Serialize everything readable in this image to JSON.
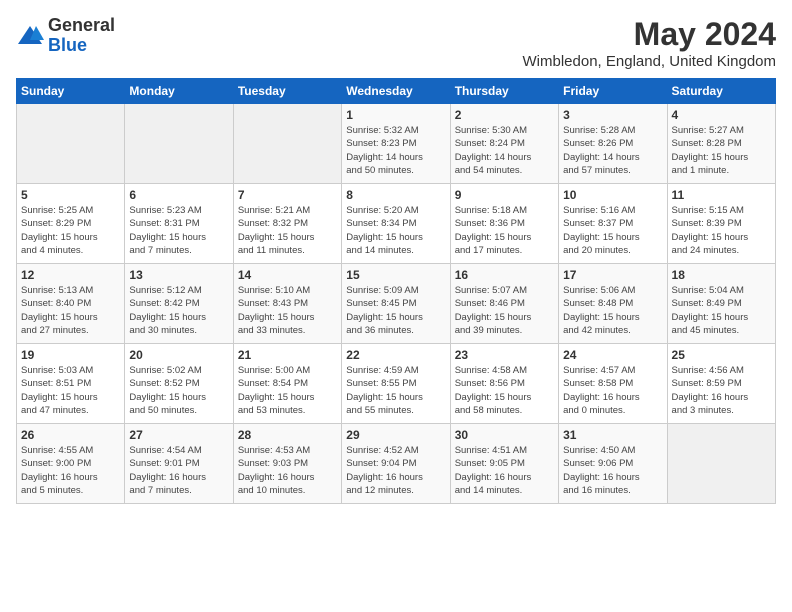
{
  "logo": {
    "general": "General",
    "blue": "Blue"
  },
  "title": "May 2024",
  "location": "Wimbledon, England, United Kingdom",
  "days_of_week": [
    "Sunday",
    "Monday",
    "Tuesday",
    "Wednesday",
    "Thursday",
    "Friday",
    "Saturday"
  ],
  "weeks": [
    [
      {
        "day": "",
        "info": ""
      },
      {
        "day": "",
        "info": ""
      },
      {
        "day": "",
        "info": ""
      },
      {
        "day": "1",
        "info": "Sunrise: 5:32 AM\nSunset: 8:23 PM\nDaylight: 14 hours\nand 50 minutes."
      },
      {
        "day": "2",
        "info": "Sunrise: 5:30 AM\nSunset: 8:24 PM\nDaylight: 14 hours\nand 54 minutes."
      },
      {
        "day": "3",
        "info": "Sunrise: 5:28 AM\nSunset: 8:26 PM\nDaylight: 14 hours\nand 57 minutes."
      },
      {
        "day": "4",
        "info": "Sunrise: 5:27 AM\nSunset: 8:28 PM\nDaylight: 15 hours\nand 1 minute."
      }
    ],
    [
      {
        "day": "5",
        "info": "Sunrise: 5:25 AM\nSunset: 8:29 PM\nDaylight: 15 hours\nand 4 minutes."
      },
      {
        "day": "6",
        "info": "Sunrise: 5:23 AM\nSunset: 8:31 PM\nDaylight: 15 hours\nand 7 minutes."
      },
      {
        "day": "7",
        "info": "Sunrise: 5:21 AM\nSunset: 8:32 PM\nDaylight: 15 hours\nand 11 minutes."
      },
      {
        "day": "8",
        "info": "Sunrise: 5:20 AM\nSunset: 8:34 PM\nDaylight: 15 hours\nand 14 minutes."
      },
      {
        "day": "9",
        "info": "Sunrise: 5:18 AM\nSunset: 8:36 PM\nDaylight: 15 hours\nand 17 minutes."
      },
      {
        "day": "10",
        "info": "Sunrise: 5:16 AM\nSunset: 8:37 PM\nDaylight: 15 hours\nand 20 minutes."
      },
      {
        "day": "11",
        "info": "Sunrise: 5:15 AM\nSunset: 8:39 PM\nDaylight: 15 hours\nand 24 minutes."
      }
    ],
    [
      {
        "day": "12",
        "info": "Sunrise: 5:13 AM\nSunset: 8:40 PM\nDaylight: 15 hours\nand 27 minutes."
      },
      {
        "day": "13",
        "info": "Sunrise: 5:12 AM\nSunset: 8:42 PM\nDaylight: 15 hours\nand 30 minutes."
      },
      {
        "day": "14",
        "info": "Sunrise: 5:10 AM\nSunset: 8:43 PM\nDaylight: 15 hours\nand 33 minutes."
      },
      {
        "day": "15",
        "info": "Sunrise: 5:09 AM\nSunset: 8:45 PM\nDaylight: 15 hours\nand 36 minutes."
      },
      {
        "day": "16",
        "info": "Sunrise: 5:07 AM\nSunset: 8:46 PM\nDaylight: 15 hours\nand 39 minutes."
      },
      {
        "day": "17",
        "info": "Sunrise: 5:06 AM\nSunset: 8:48 PM\nDaylight: 15 hours\nand 42 minutes."
      },
      {
        "day": "18",
        "info": "Sunrise: 5:04 AM\nSunset: 8:49 PM\nDaylight: 15 hours\nand 45 minutes."
      }
    ],
    [
      {
        "day": "19",
        "info": "Sunrise: 5:03 AM\nSunset: 8:51 PM\nDaylight: 15 hours\nand 47 minutes."
      },
      {
        "day": "20",
        "info": "Sunrise: 5:02 AM\nSunset: 8:52 PM\nDaylight: 15 hours\nand 50 minutes."
      },
      {
        "day": "21",
        "info": "Sunrise: 5:00 AM\nSunset: 8:54 PM\nDaylight: 15 hours\nand 53 minutes."
      },
      {
        "day": "22",
        "info": "Sunrise: 4:59 AM\nSunset: 8:55 PM\nDaylight: 15 hours\nand 55 minutes."
      },
      {
        "day": "23",
        "info": "Sunrise: 4:58 AM\nSunset: 8:56 PM\nDaylight: 15 hours\nand 58 minutes."
      },
      {
        "day": "24",
        "info": "Sunrise: 4:57 AM\nSunset: 8:58 PM\nDaylight: 16 hours\nand 0 minutes."
      },
      {
        "day": "25",
        "info": "Sunrise: 4:56 AM\nSunset: 8:59 PM\nDaylight: 16 hours\nand 3 minutes."
      }
    ],
    [
      {
        "day": "26",
        "info": "Sunrise: 4:55 AM\nSunset: 9:00 PM\nDaylight: 16 hours\nand 5 minutes."
      },
      {
        "day": "27",
        "info": "Sunrise: 4:54 AM\nSunset: 9:01 PM\nDaylight: 16 hours\nand 7 minutes."
      },
      {
        "day": "28",
        "info": "Sunrise: 4:53 AM\nSunset: 9:03 PM\nDaylight: 16 hours\nand 10 minutes."
      },
      {
        "day": "29",
        "info": "Sunrise: 4:52 AM\nSunset: 9:04 PM\nDaylight: 16 hours\nand 12 minutes."
      },
      {
        "day": "30",
        "info": "Sunrise: 4:51 AM\nSunset: 9:05 PM\nDaylight: 16 hours\nand 14 minutes."
      },
      {
        "day": "31",
        "info": "Sunrise: 4:50 AM\nSunset: 9:06 PM\nDaylight: 16 hours\nand 16 minutes."
      },
      {
        "day": "",
        "info": ""
      }
    ]
  ]
}
